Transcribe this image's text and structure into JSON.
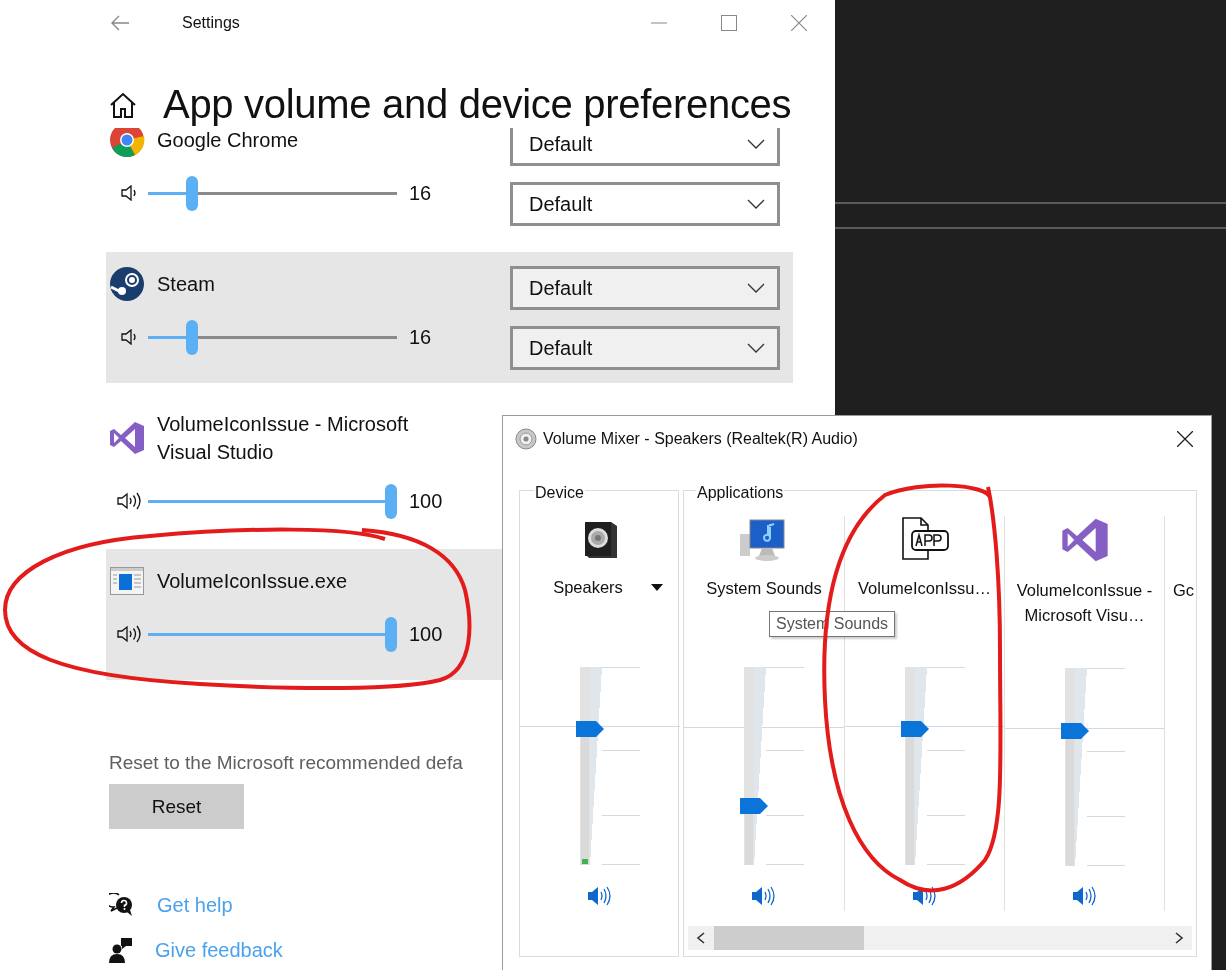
{
  "settings": {
    "window": {
      "title": "Settings"
    },
    "page_title": "App volume and device preferences",
    "apps": [
      {
        "name": "Google Chrome",
        "kind": "chrome",
        "level": 0.16,
        "value": "16",
        "selected": false,
        "output": "Default",
        "input": "Default"
      },
      {
        "name": "Steam",
        "kind": "steam",
        "level": 0.16,
        "value": "16",
        "selected": true,
        "output": "Default",
        "input": "Default"
      },
      {
        "name": "VolumeIconIssue - Microsoft Visual Studio",
        "kind": "vs",
        "level": 1,
        "value": "100",
        "selected": false
      },
      {
        "name": "VolumeIconIssue.exe",
        "kind": "exe",
        "level": 1,
        "value": "100",
        "selected": true
      }
    ],
    "reset": {
      "description": "Reset to the Microsoft recommended defa",
      "button": "Reset"
    },
    "links": [
      {
        "label": "Get help",
        "kind": "help"
      },
      {
        "label": "Give feedback",
        "kind": "feedback"
      }
    ]
  },
  "mixer": {
    "window": {
      "title": "Volume Mixer - Speakers (Realtek(R) Audio)"
    },
    "device": {
      "heading": "Device",
      "name": "Speakers",
      "level": 0.7
    },
    "applications_heading": "Applications",
    "applications": [
      {
        "name": "System Sounds",
        "kind": "system",
        "level": 0.28
      },
      {
        "name": "VolumeIconIssu…",
        "kind": "app",
        "level": 0.7
      },
      {
        "name": "VolumeIconIssue - Microsoft Visu…",
        "kind": "vs",
        "level": 0.7
      },
      {
        "name": "Gc",
        "kind": "cut"
      }
    ],
    "tooltip": "System Sounds"
  }
}
